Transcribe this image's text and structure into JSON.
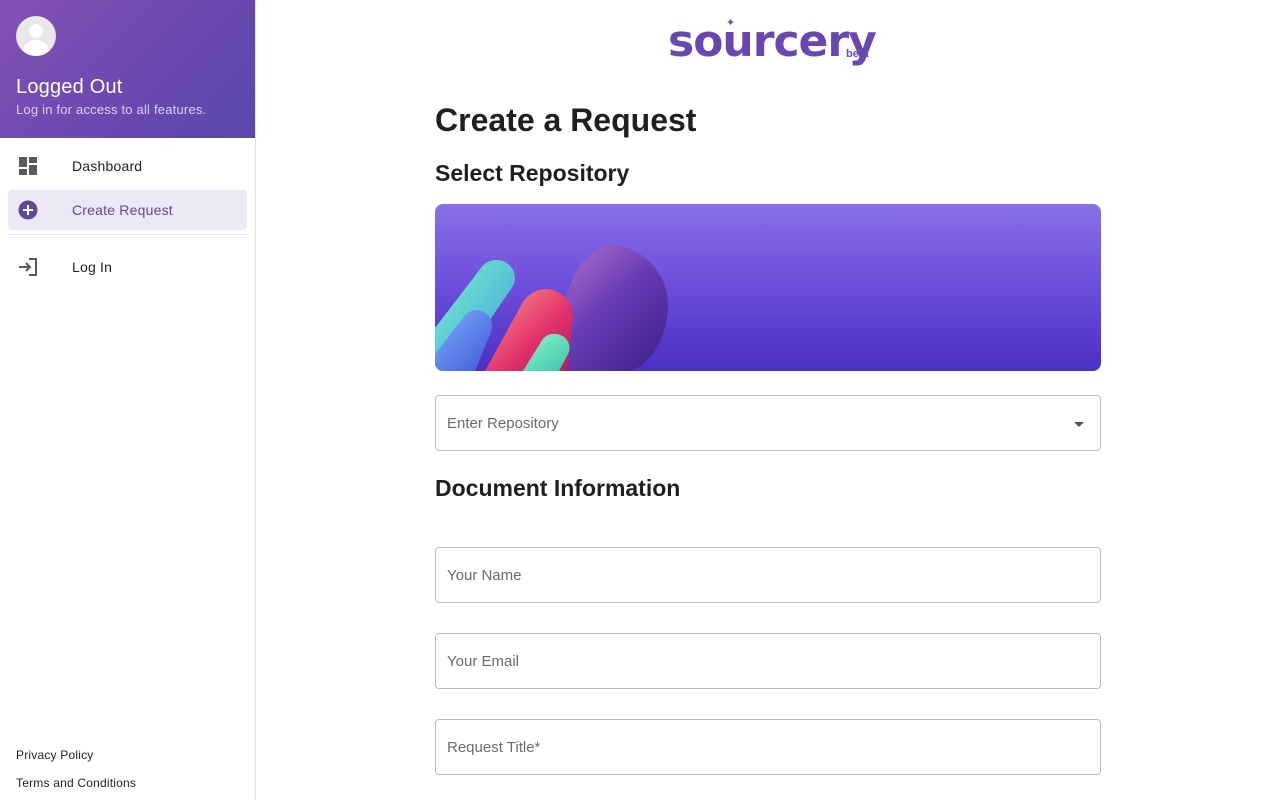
{
  "sidebar": {
    "user": {
      "status": "Logged Out",
      "subtitle": "Log in for access to all features."
    },
    "items": [
      {
        "label": "Dashboard",
        "icon": "dashboard-icon"
      },
      {
        "label": "Create Request",
        "icon": "add-circle-icon",
        "active": true
      },
      {
        "label": "Log In",
        "icon": "login-icon"
      }
    ],
    "footer": {
      "privacy": "Privacy Policy",
      "terms": "Terms and Conditions"
    }
  },
  "brand": {
    "name": "sourcery",
    "badge": "beta",
    "color": "#6a47b0"
  },
  "main": {
    "title": "Create a Request",
    "repo_section": "Select Repository",
    "repo_placeholder": "Enter Repository",
    "doc_section": "Document Information",
    "name_placeholder": "Your Name",
    "email_placeholder": "Your Email",
    "request_title_placeholder": "Request Title*"
  },
  "colors": {
    "accent": "#6a47b0",
    "active_bg": "#ece8f5"
  }
}
